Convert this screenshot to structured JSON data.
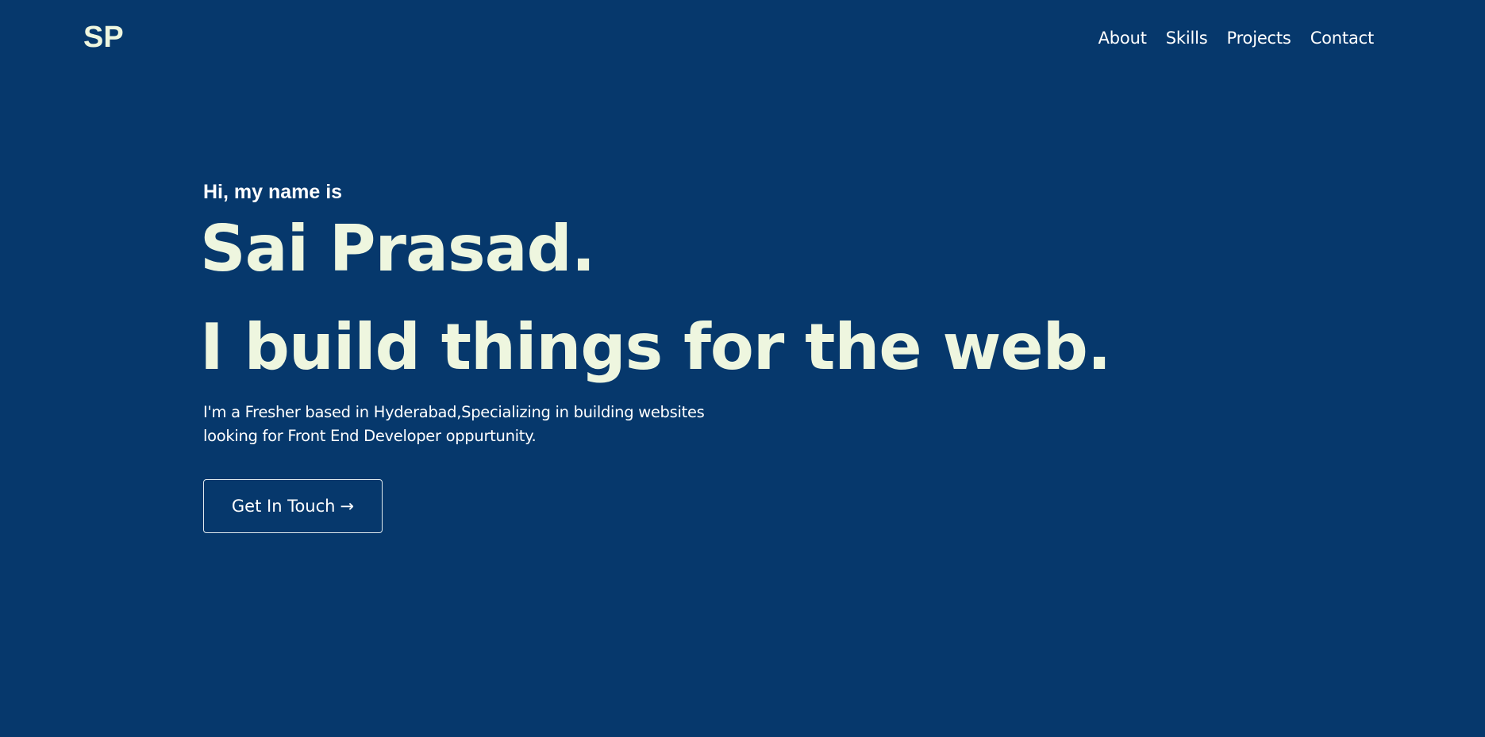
{
  "nav": {
    "logo": "SP",
    "links": [
      {
        "label": "About"
      },
      {
        "label": "Skills"
      },
      {
        "label": "Projects"
      },
      {
        "label": "Contact"
      }
    ]
  },
  "hero": {
    "greeting": "Hi, my name is",
    "name": "Sai Prasad.",
    "tagline": "I build things for the web.",
    "description_line1": "I'm a Fresher based in Hyderabad,Specializing in building websites",
    "description_line2": "looking for Front End Developer oppurtunity.",
    "cta_label": "Get In Touch",
    "cta_arrow": "→"
  },
  "colors": {
    "background": "#06386c",
    "heading": "#eef6df",
    "text": "#ffffff"
  }
}
